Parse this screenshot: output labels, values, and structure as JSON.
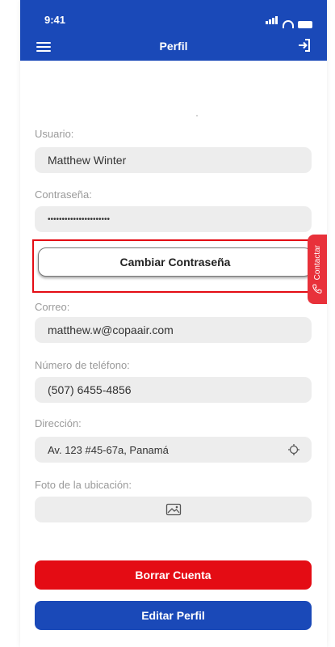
{
  "status_bar": {
    "time": "9:41"
  },
  "header": {
    "title": "Perfil"
  },
  "fields": {
    "username": {
      "label": "Usuario:",
      "value": "Matthew Winter"
    },
    "password": {
      "label": "Contraseña:",
      "value": "••••••••••••••••••••••"
    },
    "email": {
      "label": "Correo:",
      "value": "matthew.w@copaair.com"
    },
    "phone": {
      "label": "Número de teléfono:",
      "value": "(507) 6455-4856"
    },
    "address": {
      "label": "Dirección:",
      "value": "Av. 123 #45-67a, Panamá"
    },
    "location_photo": {
      "label": "Foto de la ubicación:"
    }
  },
  "buttons": {
    "change_password": "Cambiar Contraseña",
    "delete_account": "Borrar Cuenta",
    "edit_profile": "Editar Perfil"
  },
  "side_tab": {
    "label": "Contactar"
  },
  "colors": {
    "primary_blue": "#1a49b8",
    "danger_red": "#e40c14",
    "field_bg": "#ededed"
  },
  "icons": [
    "menu-icon",
    "logout-icon",
    "phone-icon",
    "location-target-icon",
    "image-icon"
  ]
}
